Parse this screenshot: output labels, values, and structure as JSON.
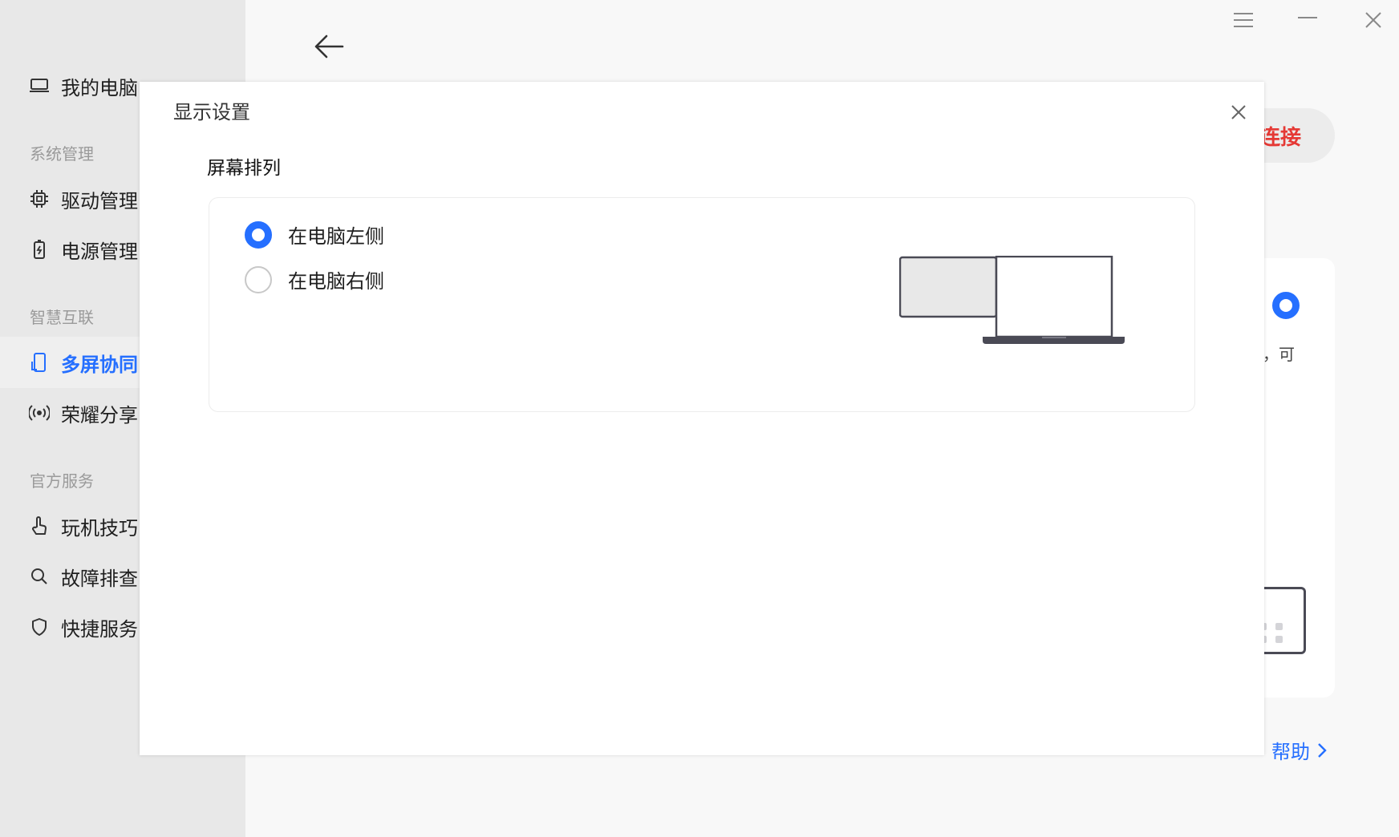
{
  "sidebar": {
    "items": [
      {
        "label": "我的电脑",
        "icon": "laptop-icon"
      },
      {
        "label": "驱动管理",
        "icon": "chip-icon"
      },
      {
        "label": "电源管理",
        "icon": "battery-icon"
      },
      {
        "label": "多屏协同",
        "icon": "multi-screen-icon"
      },
      {
        "label": "荣耀分享",
        "icon": "broadcast-icon"
      },
      {
        "label": "玩机技巧",
        "icon": "touch-icon"
      },
      {
        "label": "故障排查",
        "icon": "search-icon"
      },
      {
        "label": "快捷服务",
        "icon": "shield-icon"
      }
    ],
    "groups": [
      "系统管理",
      "智慧互联",
      "官方服务"
    ]
  },
  "main": {
    "connect_label": "连接",
    "card_text": "，可",
    "help_label": "帮助"
  },
  "dialog": {
    "title": "显示设置",
    "section_title": "屏幕排列",
    "options": [
      {
        "label": "在电脑左侧",
        "selected": true
      },
      {
        "label": "在电脑右侧",
        "selected": false
      }
    ]
  },
  "colors": {
    "accent": "#256fff",
    "danger": "#e53935",
    "sidebar_bg": "#e8e8e8"
  }
}
